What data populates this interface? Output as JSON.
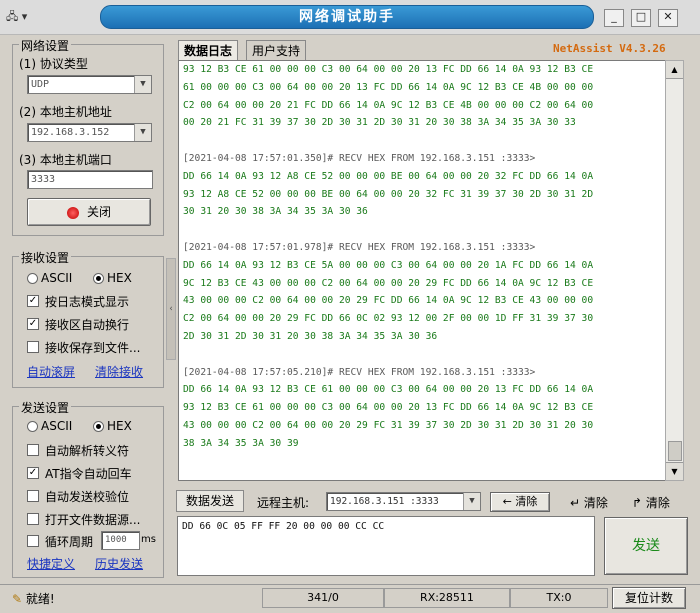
{
  "app": {
    "title": "网络调试助手",
    "menu_icon": "network-icon",
    "version": "NetAssist V4.3.26"
  },
  "tabs": [
    {
      "label": "数据日志"
    },
    {
      "label": "用户支持"
    }
  ],
  "network": {
    "group_label": "网络设置",
    "protocol_label": "(1) 协议类型",
    "protocol_value": "UDP",
    "host_label": "(2) 本地主机地址",
    "host_value": "192.168.3.152",
    "port_label": "(3) 本地主机端口",
    "port_value": "3333",
    "close_button": "关闭"
  },
  "receive": {
    "group_label": "接收设置",
    "ascii": "ASCII",
    "hex": "HEX",
    "opt1": "按日志模式显示",
    "opt2": "接收区自动换行",
    "opt3": "接收保存到文件...",
    "link_autoscroll": "自动滚屏",
    "link_clear": "清除接收"
  },
  "send": {
    "group_label": "发送设置",
    "ascii": "ASCII",
    "hex": "HEX",
    "opt1": "自动解析转义符",
    "opt2": "AT指令自动回车",
    "opt3": "自动发送校验位",
    "opt4": "打开文件数据源...",
    "opt5": "循环周期",
    "period_value": "1000",
    "period_unit": "ms",
    "link_shortcut": "快捷定义",
    "link_history": "历史发送"
  },
  "log_lines": [
    {
      "t": "hex",
      "text": "93 12 B3 CE 61 00 00 00 C3 00 64 00 00 20 13 FC DD 66 14 0A 93 12 B3 CE"
    },
    {
      "t": "hex",
      "text": "61 00 00 00 C3 00 64 00 00 20 13 FC DD 66 14 0A 9C 12 B3 CE 4B 00 00 00"
    },
    {
      "t": "hex",
      "text": "C2 00 64 00 00 20 21 FC DD 66 14 0A 9C 12 B3 CE 4B 00 00 00 C2 00 64 00"
    },
    {
      "t": "hex",
      "text": "00 20 21 FC 31 39 37 30 2D 30 31 2D 30 31 20 30 38 3A 34 35 3A 30 33"
    },
    {
      "t": "blank",
      "text": ""
    },
    {
      "t": "hdr",
      "text": "[2021-04-08 17:57:01.350]# RECV HEX FROM 192.168.3.151 :3333>"
    },
    {
      "t": "hex",
      "text": "DD 66 14 0A 93 12 A8 CE 52 00 00 00 BE 00 64 00 00 20 32 FC DD 66 14 0A"
    },
    {
      "t": "hex",
      "text": "93 12 A8 CE 52 00 00 00 BE 00 64 00 00 20 32 FC 31 39 37 30 2D 30 31 2D"
    },
    {
      "t": "hex",
      "text": "30 31 20 30 38 3A 34 35 3A 30 36"
    },
    {
      "t": "blank",
      "text": ""
    },
    {
      "t": "hdr",
      "text": "[2021-04-08 17:57:01.978]# RECV HEX FROM 192.168.3.151 :3333>"
    },
    {
      "t": "hex",
      "text": "DD 66 14 0A 93 12 B3 CE 5A 00 00 00 C3 00 64 00 00 20 1A FC DD 66 14 0A"
    },
    {
      "t": "hex",
      "text": "9C 12 B3 CE 43 00 00 00 C2 00 64 00 00 20 29 FC DD 66 14 0A 9C 12 B3 CE"
    },
    {
      "t": "hex",
      "text": "43 00 00 00 C2 00 64 00 00 20 29 FC DD 66 14 0A 9C 12 B3 CE 43 00 00 00"
    },
    {
      "t": "hex",
      "text": "C2 00 64 00 00 20 29 FC DD 66 0C 02 93 12 00 2F 00 00 1D FF 31 39 37 30"
    },
    {
      "t": "hex",
      "text": "2D 30 31 2D 30 31 20 30 38 3A 34 35 3A 30 36"
    },
    {
      "t": "blank",
      "text": ""
    },
    {
      "t": "hdr",
      "text": "[2021-04-08 17:57:05.210]# RECV HEX FROM 192.168.3.151 :3333>"
    },
    {
      "t": "hex",
      "text": "DD 66 14 0A 93 12 B3 CE 61 00 00 00 C3 00 64 00 00 20 13 FC DD 66 14 0A"
    },
    {
      "t": "hex",
      "text": "93 12 B3 CE 61 00 00 00 C3 00 64 00 00 20 13 FC DD 66 14 0A 9C 12 B3 CE"
    },
    {
      "t": "hex",
      "text": "43 00 00 00 C2 00 64 00 00 20 29 FC 31 39 37 30 2D 30 31 2D 30 31 20 30"
    },
    {
      "t": "hex",
      "text": "38 3A 34 35 3A 30 39"
    }
  ],
  "send_bar": {
    "tab": "数据发送",
    "remote_label": "远程主机:",
    "remote_value": "192.168.3.151 :3333",
    "clear1": "清除",
    "clear2": "清除",
    "clear3": "清除",
    "input_value": "DD 66 0C 05 FF FF 20 00 00 00 CC CC",
    "send_button": "发送"
  },
  "status": {
    "ready": "就绪!",
    "count": "341/0",
    "rx": "RX:28511",
    "tx": "TX:0",
    "reset": "复位计数"
  }
}
